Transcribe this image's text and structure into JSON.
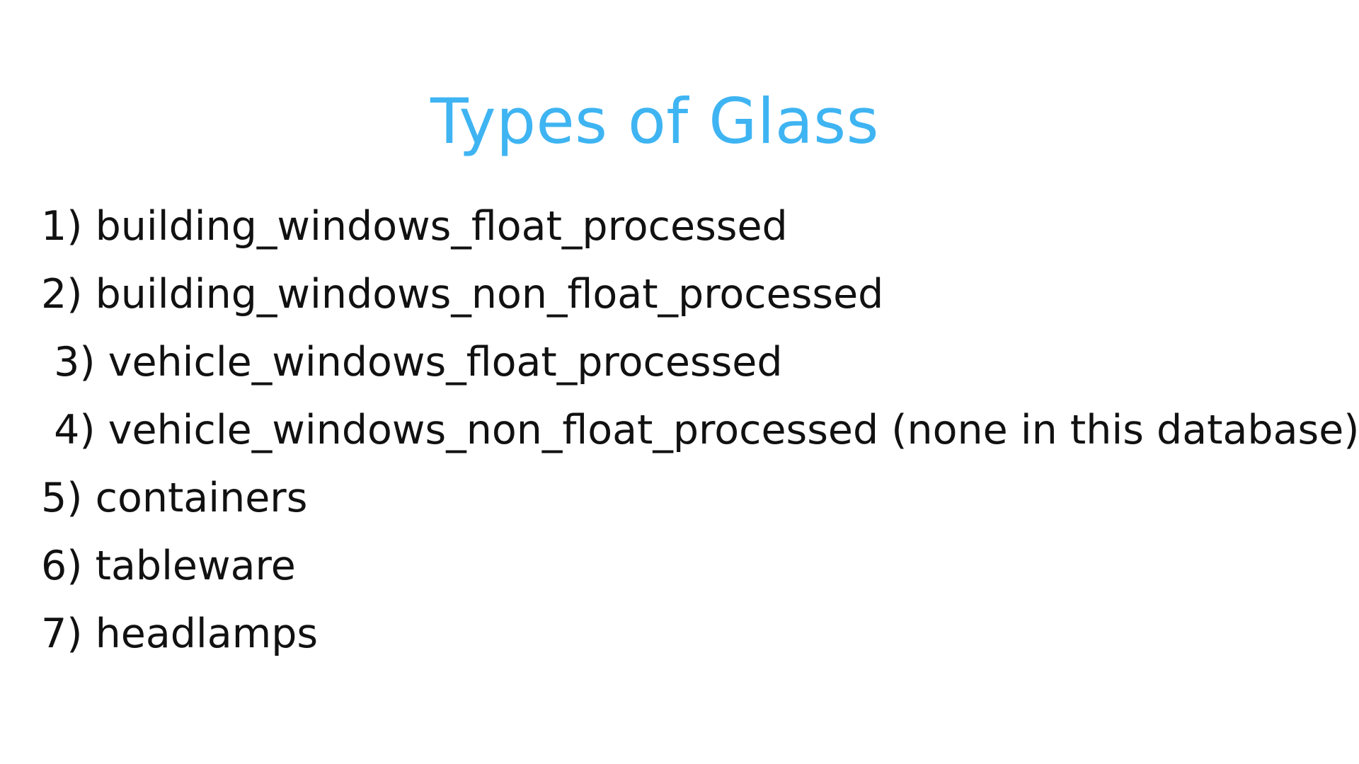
{
  "title": "Types of Glass",
  "colors": {
    "title": "#3fb4f2",
    "text": "#111111",
    "background": "#ffffff"
  },
  "items": [
    "1) building_windows_float_processed",
    "2) building_windows_non_float_processed",
    " 3) vehicle_windows_float_processed",
    " 4) vehicle_windows_non_float_processed (none in this database)",
    "5) containers",
    "6) tableware",
    "7) headlamps"
  ]
}
